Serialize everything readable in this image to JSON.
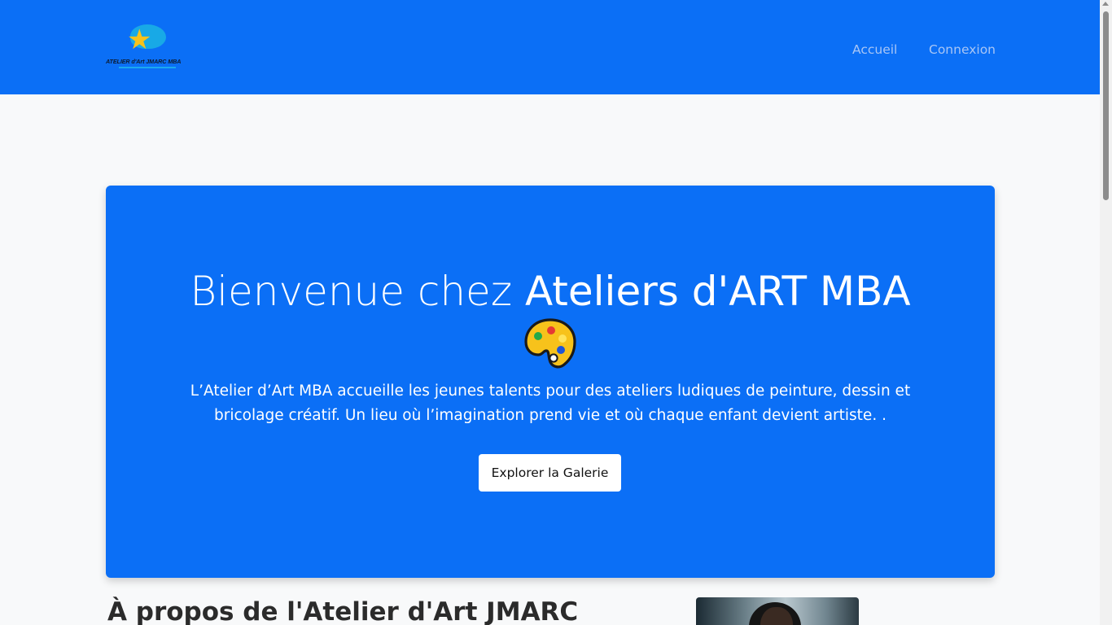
{
  "brand": {
    "logo_text": "ATELIER d'Art JMARC MBA",
    "accent_color": "#0b6ff6",
    "star_color": "#f7c21b"
  },
  "nav": {
    "items": [
      {
        "label": "Accueil"
      },
      {
        "label": "Connexion"
      }
    ]
  },
  "hero": {
    "title_prefix": "Bienvenue chez ",
    "title_strong": "Ateliers d'ART MBA",
    "icon": "palette-icon",
    "text": "L’Atelier d’Art MBA accueille les jeunes talents pour des ateliers ludiques de peinture, dessin et bricolage créatif. Un lieu où l’imagination prend vie et où chaque enfant devient artiste. .",
    "button_label": "Explorer la Galerie"
  },
  "about": {
    "title": "À propos de l'Atelier d'Art JMARC"
  }
}
